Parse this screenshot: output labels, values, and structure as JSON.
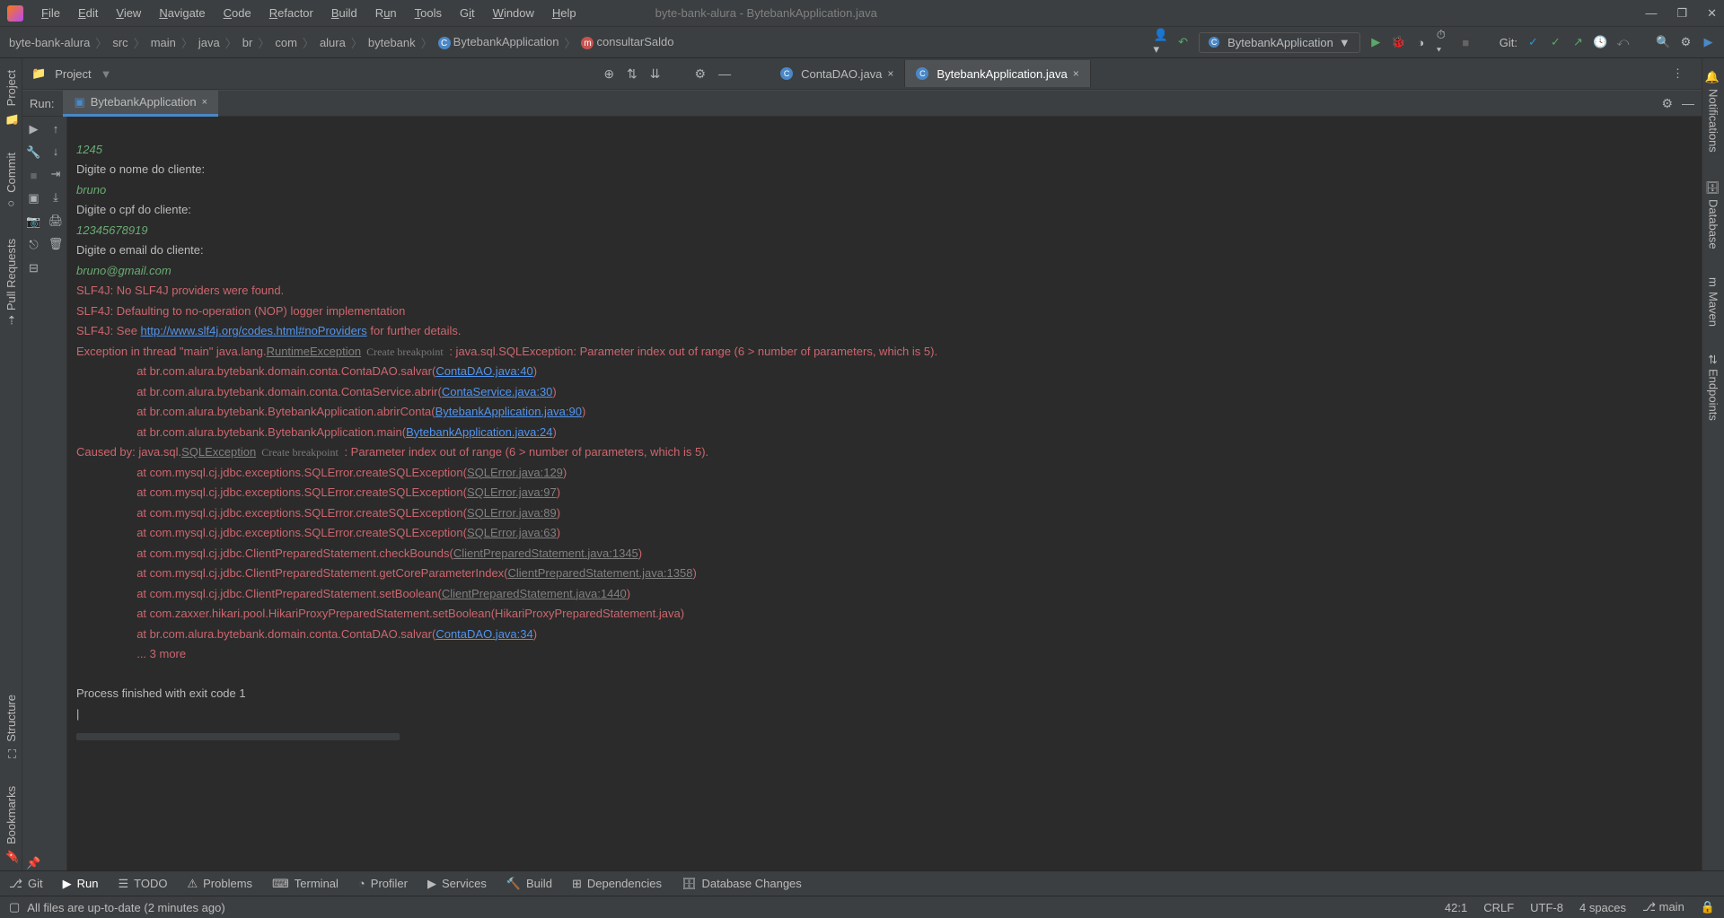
{
  "titlebar": {
    "menus": [
      "File",
      "Edit",
      "View",
      "Navigate",
      "Code",
      "Refactor",
      "Build",
      "Run",
      "Tools",
      "Git",
      "Window",
      "Help"
    ],
    "title": "byte-bank-alura - BytebankApplication.java"
  },
  "breadcrumb": [
    "byte-bank-alura",
    "src",
    "main",
    "java",
    "br",
    "com",
    "alura",
    "bytebank",
    "BytebankApplication",
    "consultarSaldo"
  ],
  "runconfig": "BytebankApplication",
  "navright_gitlabel": "Git:",
  "project_panel_label": "Project",
  "tabs": {
    "file1": "ContaDAO.java",
    "file2": "BytebankApplication.java"
  },
  "run_label": "Run:",
  "run_tab": "BytebankApplication",
  "console": {
    "l1": "1245",
    "l2": "Digite o nome do cliente:",
    "l3": "bruno",
    "l4": "Digite o cpf do cliente:",
    "l5": "12345678919",
    "l6": "Digite o email do cliente:",
    "l7": "bruno@gmail.com",
    "l8": "SLF4J: No SLF4J providers were found.",
    "l9": "SLF4J: Defaulting to no-operation (NOP) logger implementation",
    "l10a": "SLF4J: See ",
    "l10b": "http://www.slf4j.org/codes.html#noProviders",
    "l10c": " for further details.",
    "ex1a": "Exception in thread \"main\" java.lang.",
    "ex1b": "RuntimeException",
    "ex1hint": "  Create breakpoint ",
    "ex1c": " : java.sql.SQLException: Parameter index out of range (6 > number of parameters, which is 5).",
    "at1a": "\tat br.com.alura.bytebank.domain.conta.ContaDAO.salvar(",
    "at1b": "ContaDAO.java:40",
    "at1c": ")",
    "at2a": "\tat br.com.alura.bytebank.domain.conta.ContaService.abrir(",
    "at2b": "ContaService.java:30",
    "at2c": ")",
    "at3a": "\tat br.com.alura.bytebank.BytebankApplication.abrirConta(",
    "at3b": "BytebankApplication.java:90",
    "at3c": ")",
    "at4a": "\tat br.com.alura.bytebank.BytebankApplication.main(",
    "at4b": "BytebankApplication.java:24",
    "at4c": ")",
    "cb1a": "Caused by: java.sql.",
    "cb1b": "SQLException",
    "cb1hint": "  Create breakpoint ",
    "cb1c": " : Parameter index out of range (6 > number of parameters, which is 5).",
    "cat1a": "\tat com.mysql.cj.jdbc.exceptions.SQLError.createSQLException(",
    "cat1b": "SQLError.java:129",
    "cat1c": ")",
    "cat2a": "\tat com.mysql.cj.jdbc.exceptions.SQLError.createSQLException(",
    "cat2b": "SQLError.java:97",
    "cat2c": ")",
    "cat3a": "\tat com.mysql.cj.jdbc.exceptions.SQLError.createSQLException(",
    "cat3b": "SQLError.java:89",
    "cat3c": ")",
    "cat4a": "\tat com.mysql.cj.jdbc.exceptions.SQLError.createSQLException(",
    "cat4b": "SQLError.java:63",
    "cat4c": ")",
    "cat5a": "\tat com.mysql.cj.jdbc.ClientPreparedStatement.checkBounds(",
    "cat5b": "ClientPreparedStatement.java:1345",
    "cat5c": ")",
    "cat6a": "\tat com.mysql.cj.jdbc.ClientPreparedStatement.getCoreParameterIndex(",
    "cat6b": "ClientPreparedStatement.java:1358",
    "cat6c": ")",
    "cat7a": "\tat com.mysql.cj.jdbc.ClientPreparedStatement.setBoolean(",
    "cat7b": "ClientPreparedStatement.java:1440",
    "cat7c": ")",
    "cat8": "\tat com.zaxxer.hikari.pool.HikariProxyPreparedStatement.setBoolean(HikariProxyPreparedStatement.java)",
    "cat9a": "\tat br.com.alura.bytebank.domain.conta.ContaDAO.salvar(",
    "cat9b": "ContaDAO.java:34",
    "cat9c": ")",
    "more": "\t... 3 more",
    "exit": "Process finished with exit code 1"
  },
  "bottom": {
    "git": "Git",
    "run": "Run",
    "todo": "TODO",
    "problems": "Problems",
    "terminal": "Terminal",
    "profiler": "Profiler",
    "services": "Services",
    "build": "Build",
    "dependencies": "Dependencies",
    "dbchanges": "Database Changes"
  },
  "status": {
    "left": "All files are up-to-date (2 minutes ago)",
    "pos": "42:1",
    "crlf": "CRLF",
    "enc": "UTF-8",
    "indent": "4 spaces",
    "branch": "main"
  },
  "sidebars": {
    "project": "Project",
    "commit": "Commit",
    "pull": "Pull Requests",
    "structure": "Structure",
    "bookmarks": "Bookmarks",
    "notif": "Notifications",
    "db": "Database",
    "maven": "Maven",
    "endpoints": "Endpoints"
  }
}
